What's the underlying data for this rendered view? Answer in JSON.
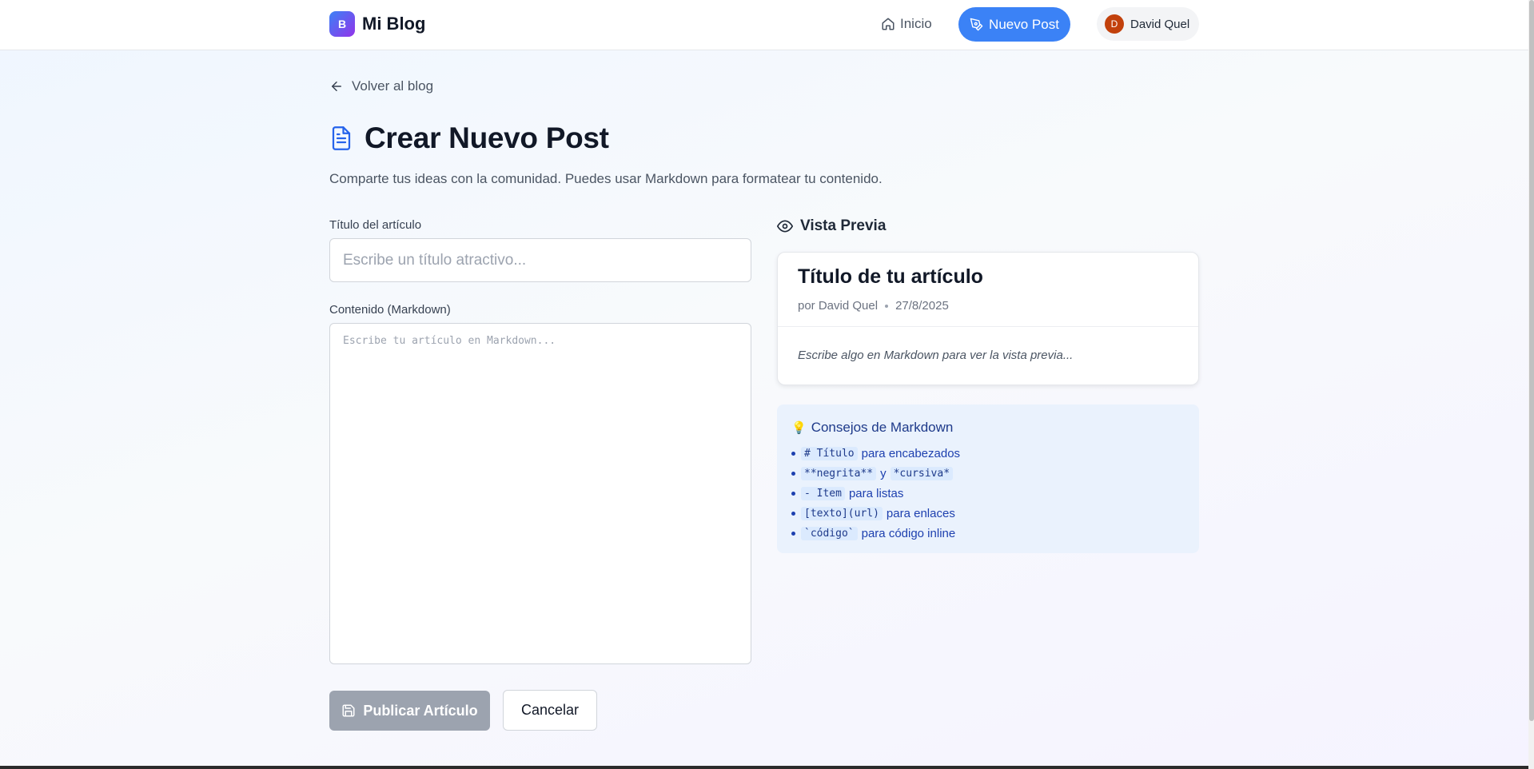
{
  "header": {
    "logo_letter": "B",
    "logo_text": "Mi Blog",
    "nav_home": "Inicio",
    "nav_new_post": "Nuevo Post",
    "user_initial": "D",
    "user_name": "David Quel"
  },
  "back_link": "Volver al blog",
  "page": {
    "title": "Crear Nuevo Post",
    "subtitle": "Comparte tus ideas con la comunidad. Puedes usar Markdown para formatear tu contenido."
  },
  "form": {
    "title_label": "Título del artículo",
    "title_placeholder": "Escribe un título atractivo...",
    "title_value": "",
    "content_label": "Contenido (Markdown)",
    "content_placeholder": "Escribe tu artículo en Markdown...",
    "content_value": "",
    "publish_label": "Publicar Artículo",
    "cancel_label": "Cancelar"
  },
  "preview": {
    "heading": "Vista Previa",
    "title": "Título de tu artículo",
    "author": "por David Quel",
    "date": "27/8/2025",
    "empty_text": "Escribe algo en Markdown para ver la vista previa..."
  },
  "tips": {
    "icon": "💡",
    "title": "Consejos de Markdown",
    "items": [
      {
        "code": "# Título",
        "text": "para encabezados"
      },
      {
        "code": "**negrita**",
        "mid": "y",
        "code2": "*cursiva*"
      },
      {
        "code": "- Item",
        "text": "para listas"
      },
      {
        "code": "[texto](url)",
        "text": "para enlaces"
      },
      {
        "code": "`código`",
        "text": "para código inline"
      }
    ]
  },
  "colors": {
    "accent": "#3b82f6",
    "brand_gradient_start": "#3b82f6",
    "brand_gradient_end": "#9333ea",
    "publish_disabled": "#9ca3af",
    "avatar": "#c2410c"
  }
}
